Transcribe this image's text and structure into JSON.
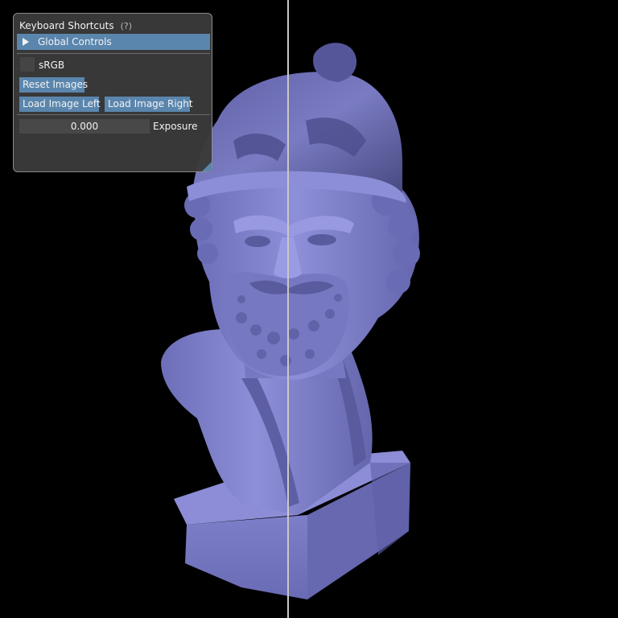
{
  "panel": {
    "title": "Keyboard Shortcuts",
    "help": "(?)",
    "global_controls_label": "Global Controls",
    "srgb_label": "sRGB",
    "srgb_checked": false,
    "reset_images_label": "Reset Images",
    "load_left_label": "Load Image Left",
    "load_right_label": "Load Image Right",
    "exposure_value": "0.000",
    "exposure_label": "Exposure"
  },
  "colors": {
    "accent": "#5a86ad",
    "panel_bg": "#3a3a3a",
    "statue": "#7f80c8",
    "split_line": "#c8c8c8"
  },
  "icons": {
    "collapse": "triangle-right-icon",
    "resize": "resize-grip-icon"
  }
}
